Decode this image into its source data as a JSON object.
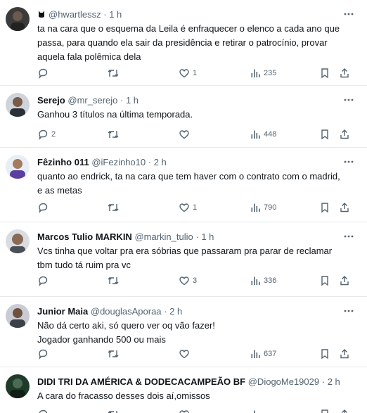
{
  "tweets": [
    {
      "display_name": "",
      "name_icon": "cat-emoji",
      "handle": "@hwartlessz",
      "dot": "·",
      "time": "1 h",
      "lines": [
        "ta na cara que o esquema da Leila é enfraquecer o elenco a cada ano que",
        "passa, para quando ela sair da presidência e retirar o patrocínio, provar",
        "aquela fala polêmica dela"
      ],
      "replies": "",
      "retweets": "",
      "likes": "1",
      "views": "235"
    },
    {
      "display_name": "Serejo",
      "handle": "@mr_serejo",
      "dot": "·",
      "time": "1 h",
      "lines": [
        "Ganhou 3 títulos na última temporada."
      ],
      "replies": "2",
      "retweets": "",
      "likes": "",
      "views": "448"
    },
    {
      "display_name": "Fêzinho 011",
      "handle": "@iFezinho10",
      "dot": "·",
      "time": "2 h",
      "lines": [
        "quanto ao endrick, ta na cara que tem haver com o contrato com o madrid,",
        "e as metas"
      ],
      "replies": "",
      "retweets": "",
      "likes": "1",
      "views": "790"
    },
    {
      "display_name": "Marcos Tulio MARKIN",
      "handle": "@markin_tulio",
      "dot": "·",
      "time": "1 h",
      "lines": [
        "Vcs tinha que voltar pra era sóbrias que passaram pra parar de reclamar",
        "tbm tudo tá ruim pra vc"
      ],
      "replies": "",
      "retweets": "",
      "likes": "3",
      "views": "336"
    },
    {
      "display_name": "Junior Maia",
      "handle": "@douglasAporaa",
      "dot": "·",
      "time": "2 h",
      "lines": [
        "Não dá certo aki, só quero ver oq vão fazer!",
        "Jogador ganhando 500 ou mais"
      ],
      "replies": "",
      "retweets": "",
      "likes": "",
      "views": "637"
    },
    {
      "display_name": "DIDI TRI DA AMÉRICA & DODECACAMPEÃO BF",
      "handle": "@DiogoMe19029",
      "dot": "·",
      "time": "2 h",
      "lines": [
        "A cara do fracasso desses dois aí,omissos"
      ],
      "replies": "",
      "retweets": "",
      "likes": "",
      "views": ""
    }
  ],
  "colors": {
    "text": "#0f1419",
    "secondary": "#536471",
    "divider": "#e7e9ea",
    "background": "#ffffff"
  }
}
